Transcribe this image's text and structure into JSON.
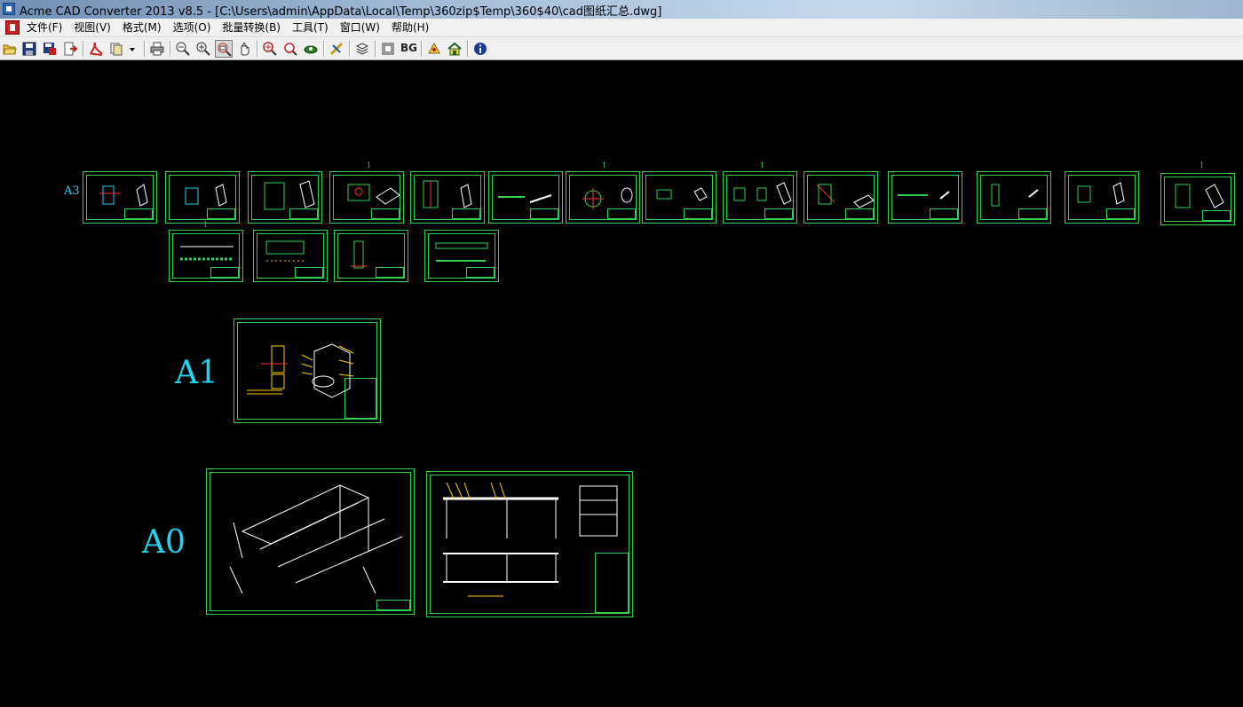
{
  "window": {
    "title": "Acme CAD Converter 2013 v8.5 - [C:\\Users\\admin\\AppData\\Local\\Temp\\360zip$Temp\\360$40\\cad图纸汇总.dwg]"
  },
  "menu": {
    "items": [
      "文件(F)",
      "视图(V)",
      "格式(M)",
      "选项(O)",
      "批量转换(B)",
      "工具(T)",
      "窗口(W)",
      "帮助(H)"
    ]
  },
  "toolbar": {
    "bg_label": "BG",
    "buttons": [
      {
        "name": "open-icon"
      },
      {
        "name": "save-icon"
      },
      {
        "name": "save-as-icon"
      },
      {
        "name": "export-icon"
      },
      {
        "name": "convert-pdf-icon"
      },
      {
        "name": "batch-convert-icon"
      },
      {
        "name": "dropdown-arrow-icon"
      },
      {
        "name": "print-icon"
      },
      {
        "name": "zoom-out-icon"
      },
      {
        "name": "zoom-in-icon"
      },
      {
        "name": "zoom-window-icon",
        "active": true
      },
      {
        "name": "pan-icon"
      },
      {
        "name": "zoom-realtime-icon"
      },
      {
        "name": "zoom-previous-icon"
      },
      {
        "name": "zoom-extents-icon"
      },
      {
        "name": "measure-icon"
      },
      {
        "name": "layers-icon"
      },
      {
        "name": "frame-icon"
      },
      {
        "name": "background-icon"
      },
      {
        "name": "settings-icon"
      },
      {
        "name": "home-icon"
      },
      {
        "name": "about-icon"
      }
    ]
  },
  "drawing": {
    "labels": {
      "a3": "A3",
      "a1": "A1",
      "a0": "A0"
    },
    "marks": [
      "1",
      "1",
      "1",
      "1",
      "1"
    ],
    "colors": {
      "frame": "#30d050",
      "line": "#ffffff",
      "label": "#22d3ee",
      "accent": "#ffcc00",
      "red": "#ff3030"
    }
  }
}
